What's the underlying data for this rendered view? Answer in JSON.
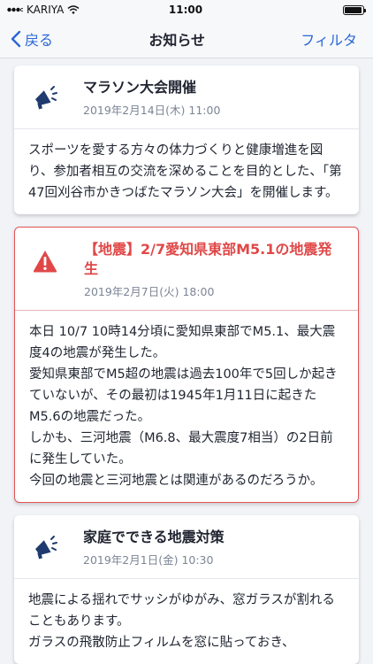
{
  "status_bar": {
    "carrier": "KARIYA",
    "time": "11:00",
    "battery_level": 0.95
  },
  "nav": {
    "back_label": "戻る",
    "title": "お知らせ",
    "filter_label": "フィルタ"
  },
  "colors": {
    "accent": "#2a67d6",
    "alert": "#e04848",
    "icon": "#1f3a6e"
  },
  "notices": [
    {
      "icon": "megaphone-icon",
      "title": "マラソン大会開催",
      "date": "2019年2月14日(木) 11:00",
      "body": "スポーツを愛する方々の体力づくりと健康増進を図り、参加者相互の交流を深めることを目的とした、「第47回刈谷市かきつばたマラソン大会」を開催します。"
    },
    {
      "icon": "warning-icon",
      "title": "【地震】2/7愛知県東部M5.1の地震発生",
      "date": "2019年2月7日(火) 18:00",
      "body": "本日 10/7 10時14分頃に愛知県東部でM5.1、最大震度4の地震が発生した。\n愛知県東部でM5超の地震は過去100年で5回しか起きていないが、その最初は1945年1月11日に起きたM5.6の地震だった。\nしかも、三河地震（M6.8、最大震度7相当）の2日前に発生していた。\n今回の地震と三河地震とは関連があるのだろうか。"
    },
    {
      "icon": "megaphone-icon",
      "title": "家庭でできる地震対策",
      "date": "2019年2月1日(金) 10:30",
      "body": "地震による揺れでサッシがゆがみ、窓ガラスが割れることもあります。\nガラスの飛散防止フィルムを窓に貼っておき、"
    }
  ]
}
